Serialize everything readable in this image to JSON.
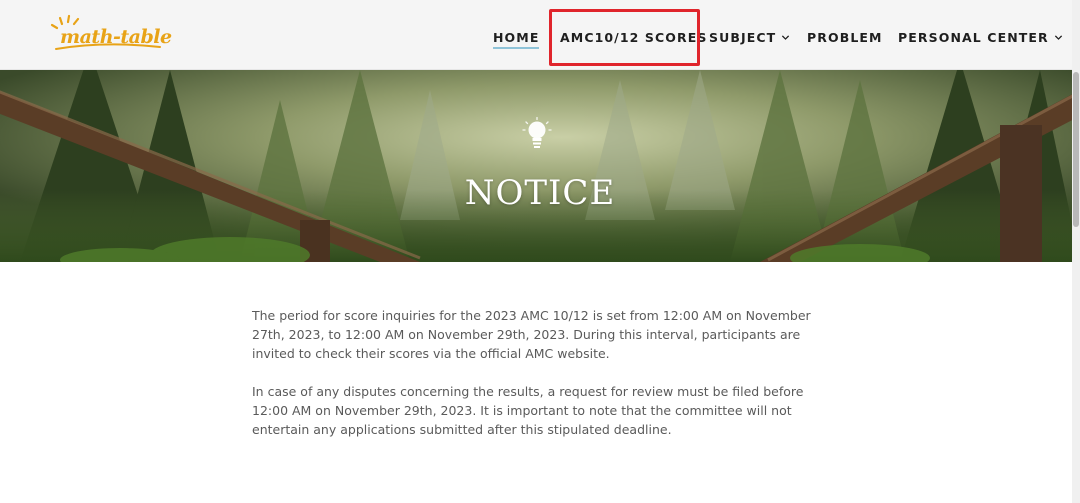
{
  "header": {
    "logo_text": "math-table",
    "nav": [
      {
        "label": "HOME",
        "active": true
      },
      {
        "label": "AMC10/12 SCORES",
        "highlighted": true
      },
      {
        "label": "SUBJECT",
        "has_dropdown": true
      },
      {
        "label": "PROBLEM"
      },
      {
        "label": "PERSONAL CENTER",
        "has_dropdown": true
      }
    ]
  },
  "hero": {
    "icon": "lightbulb-icon",
    "title": "NOTICE"
  },
  "content": {
    "paragraphs": [
      "The period for score inquiries for the 2023 AMC 10/12 is set from 12:00 AM on November 27th, 2023, to 12:00 AM on November 29th, 2023. During this interval, participants are invited to check their scores via the official AMC website.",
      "In case of any disputes concerning the results, a request for review must be filed before 12:00 AM on November 29th, 2023. It is important to note that the committee will not entertain any applications submitted after this stipulated deadline."
    ]
  },
  "colors": {
    "highlight_box": "#e0252c",
    "logo": "#e8a317",
    "active_underline": "#8fc3d8",
    "nav_text": "#1f1f1f"
  }
}
